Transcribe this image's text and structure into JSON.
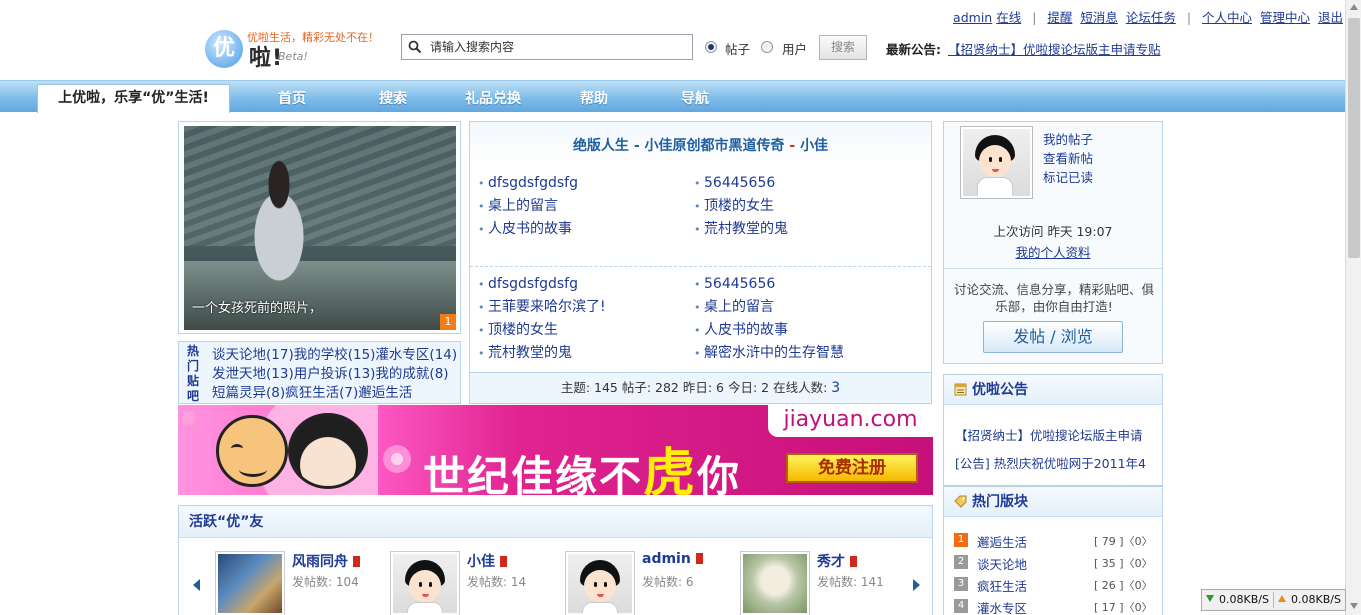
{
  "header": {
    "logo_char": "优",
    "logo_text": "啦!",
    "logo_beta": "Beta!",
    "slogan": "优啦生活，精彩无处不在！",
    "search_placeholder": "请输入搜索内容",
    "radio_posts": "帖子",
    "radio_users": "用户",
    "search_button": "搜索",
    "notice_label": "最新公告:",
    "notice_link": "【招贤纳士】优啦搜论坛版主申请专贴"
  },
  "top_links": {
    "username": "admin",
    "online": "在线",
    "remind": "提醒",
    "messages": "短消息",
    "tasks": "论坛任务",
    "personal_center": "个人中心",
    "admin_center": "管理中心",
    "logout": "退出"
  },
  "nav": {
    "current_tab": "上优啦，乐享“优”生活!",
    "items": [
      "首页",
      "搜索",
      "礼品兑换",
      "帮助",
      "导航"
    ]
  },
  "photo": {
    "caption": "一个女孩死前的照片，",
    "index": "1"
  },
  "hot_forums": {
    "label": "热门贴吧",
    "text": "谈天论地(17)我的学校(15)灌水专区(14)发泄天地(13)用户投诉(13)我的成就(8)短篇灵异(8)疯狂生活(7)邂逅生活"
  },
  "threads": {
    "headline_a": "绝版人生",
    "headline_b": "小佳原创都市黑道传奇",
    "headline_c": "小佳",
    "col1_top": [
      "dfsgdsfgdsfg",
      "桌上的留言",
      "人皮书的故事"
    ],
    "col2_top": [
      "56445656",
      "顶楼的女生",
      "荒村教堂的鬼"
    ],
    "col1_bottom": [
      "dfsgdsfgdsfg",
      "王菲要来哈尔滨了!",
      "顶楼的女生",
      "荒村教堂的鬼"
    ],
    "col2_bottom": [
      "56445656",
      "桌上的留言",
      "人皮书的故事",
      "解密水浒中的生存智慧"
    ],
    "stats_text": "主题: 145  帖子: 282  昨日: 6  今日: 2   在线人数:",
    "online_count": "3"
  },
  "banner": {
    "text_before": "世纪佳缘不",
    "text_tiger": "虎",
    "text_after": "你",
    "domain": "jiayuan.com",
    "register": "免费注册"
  },
  "friends": {
    "title": "活跃“优”友",
    "list": [
      {
        "name": "风雨同舟",
        "posts": "发帖数: 104"
      },
      {
        "name": "小佳",
        "posts": "发帖数: 14"
      },
      {
        "name": "admin",
        "posts": "发帖数: 6"
      },
      {
        "name": "秀才",
        "posts": "发帖数: 141"
      }
    ]
  },
  "user_panel": {
    "my_posts": "我的帖子",
    "view_new": "查看新帖",
    "mark_read": "标记已读",
    "last_visit": "上次访问 昨天 19:07",
    "my_profile": "我的个人资料",
    "desc": "讨论交流、信息分享，精彩贴吧、俱乐部，由你自由打造!",
    "post_button": "发帖 / 浏览"
  },
  "announcements": {
    "title": "优啦公告",
    "items": [
      "【招贤纳士】优啦搜论坛版主申请",
      "[公告] 热烈庆祝优啦网于2011年4"
    ]
  },
  "hot_boards": {
    "title": "热门版块",
    "items": [
      {
        "rank": "1",
        "name": "邂逅生活",
        "count": "[ 79 ]〈0〉"
      },
      {
        "rank": "2",
        "name": "谈天论地",
        "count": "[ 35 ]〈0〉"
      },
      {
        "rank": "3",
        "name": "疯狂生活",
        "count": "[ 26 ]〈0〉"
      },
      {
        "rank": "4",
        "name": "灌水专区",
        "count": "[ 17 ]〈0〉"
      }
    ]
  },
  "speed": {
    "download": "0.08KB/S",
    "upload": "0.08KB/S"
  },
  "colors": {
    "link": "#1f3a93",
    "nav_blue": "#62a8df",
    "accent_orange": "#f06c15"
  }
}
